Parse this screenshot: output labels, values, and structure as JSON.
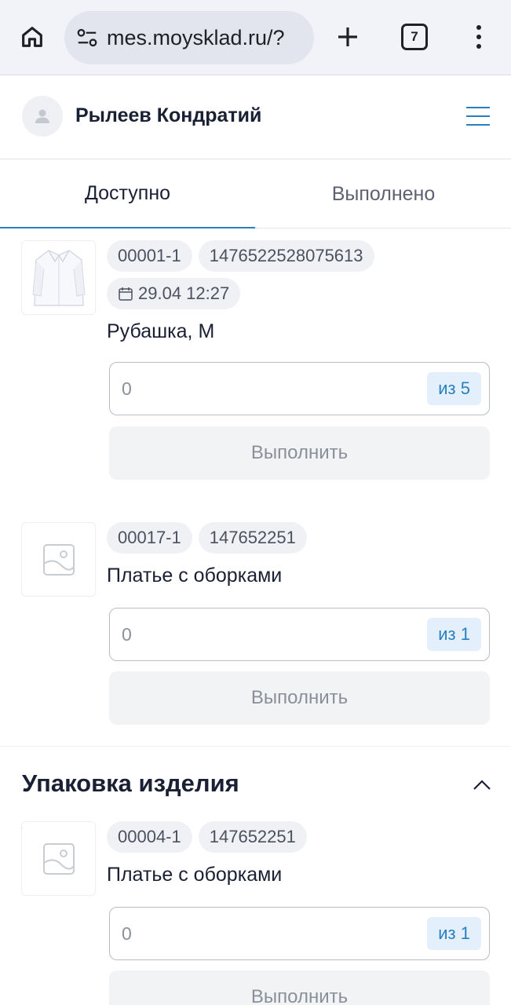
{
  "browser": {
    "url": "mes.moysklad.ru/?",
    "tab_count": "7"
  },
  "header": {
    "user_name": "Рылеев Кондратий"
  },
  "tabs": [
    {
      "label": "Доступно",
      "active": true
    },
    {
      "label": "Выполнено",
      "active": false
    }
  ],
  "items": [
    {
      "code": "00001-1",
      "barcode": "1476522528075613",
      "date": "29.04 12:27",
      "name": "Рубашка, M",
      "qty_value": "0",
      "qty_of": "из 5",
      "action": "Выполнить"
    },
    {
      "code": "00017-1",
      "barcode": "147652251",
      "name": "Платье с оборками",
      "qty_value": "0",
      "qty_of": "из 1",
      "action": "Выполнить"
    }
  ],
  "section": {
    "title": "Упаковка изделия",
    "items": [
      {
        "code": "00004-1",
        "barcode": "147652251",
        "name": "Платье с оборками",
        "qty_value": "0",
        "qty_of": "из 1",
        "action": "Выполнить"
      }
    ]
  },
  "colors": {
    "accent": "#2a7fc0",
    "chip_bg": "#f0f1f4",
    "button_disabled_bg": "#f2f3f5"
  },
  "icons": [
    "home-icon",
    "tune-icon",
    "plus-icon",
    "tabs-icon",
    "more-vert-icon",
    "avatar-icon",
    "burger-menu-icon",
    "calendar-icon",
    "image-placeholder-icon",
    "chevron-up-icon"
  ]
}
